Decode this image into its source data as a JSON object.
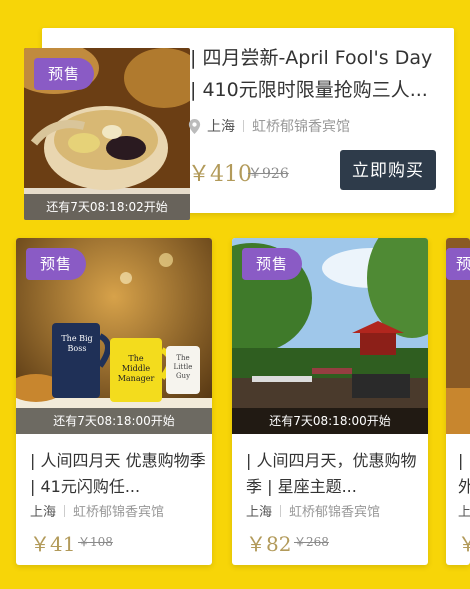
{
  "featured": {
    "badge": "预售",
    "countdown": "还有7天08:18:02开始",
    "title": "| 四月尝新-April Fool's Day | 410元限时限量抢购三人...",
    "city": "上海",
    "hotel": "虹桥郁锦香宾馆",
    "price_now": "￥410",
    "price_old": "￥926",
    "buy_label": "立即购买"
  },
  "cards": [
    {
      "badge": "预售",
      "countdown": "还有7天08:18:00开始",
      "title": "| 人间四月天 优惠购物季 | 41元闪购任...",
      "city": "上海",
      "hotel": "虹桥郁锦香宾馆",
      "price_now": "￥41",
      "price_old": "￥108",
      "mug_labels": [
        "The Big Boss",
        "The Middle Manager",
        "The Little Guy"
      ]
    },
    {
      "badge": "预售",
      "countdown": "还有7天08:18:00开始",
      "title": "| 人间四月天，优惠购物季 | 星座主题...",
      "city": "上海",
      "hotel": "虹桥郁锦香宾馆",
      "price_now": "￥82",
      "price_old": "￥268"
    },
    {
      "badge": "预售",
      "title": "| 外",
      "city": "上",
      "price_now": "￥"
    }
  ],
  "colors": {
    "background": "#f7d508",
    "badge": "#8a5bc5",
    "buy_button": "#2e3b4a",
    "price": "#b29a5a"
  },
  "icons": [
    "location-pin-icon"
  ]
}
